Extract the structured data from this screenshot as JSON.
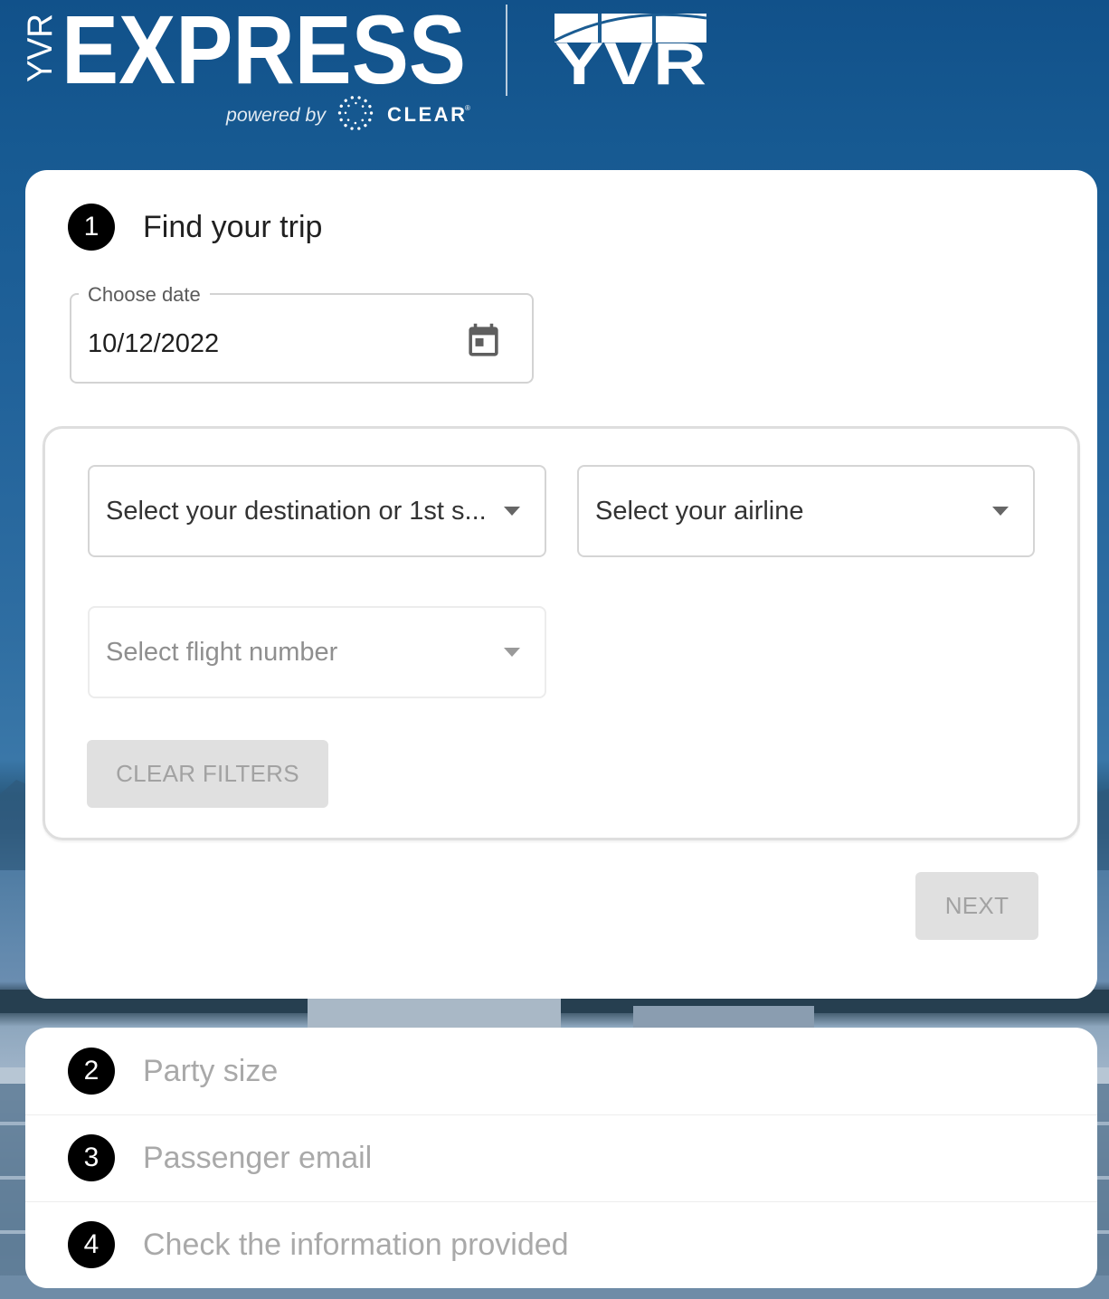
{
  "brand": {
    "yvr_vertical": "YVR",
    "express": "EXPRESS",
    "powered_by": "powered by",
    "clear": "CLEAR",
    "clear_registered": "®",
    "airport_logo": "YVR"
  },
  "colors": {
    "background": "#17588e",
    "card": "#ffffff",
    "step_badge": "#000000",
    "step_badge_text": "#ffffff",
    "active_title": "#212121",
    "inactive_title": "#a9a9a9",
    "field_text": "#333333",
    "disabled_field_text": "#8f8f8f",
    "disabled_button_bg": "#e0e0e0",
    "disabled_button_text": "#a2a2a2"
  },
  "icons": {
    "date_picker": "calendar-icon",
    "select_arrow": "arrow-drop-down-icon",
    "clear_logo": "clear-dots-icon"
  },
  "steps": [
    {
      "number": "1",
      "title": "Find your trip"
    },
    {
      "number": "2",
      "title": "Party size"
    },
    {
      "number": "3",
      "title": "Passenger email"
    },
    {
      "number": "4",
      "title": "Check the information provided"
    }
  ],
  "trip_form": {
    "date": {
      "label": "Choose date",
      "value": "10/12/2022"
    },
    "destination": {
      "placeholder": "Select your destination or 1st s...",
      "disabled": false
    },
    "airline": {
      "placeholder": "Select your airline",
      "disabled": false
    },
    "flight_number": {
      "placeholder": "Select flight number",
      "disabled": true
    },
    "clear_filters": {
      "label": "CLEAR FILTERS",
      "disabled": true
    },
    "next": {
      "label": "NEXT",
      "disabled": true
    }
  }
}
